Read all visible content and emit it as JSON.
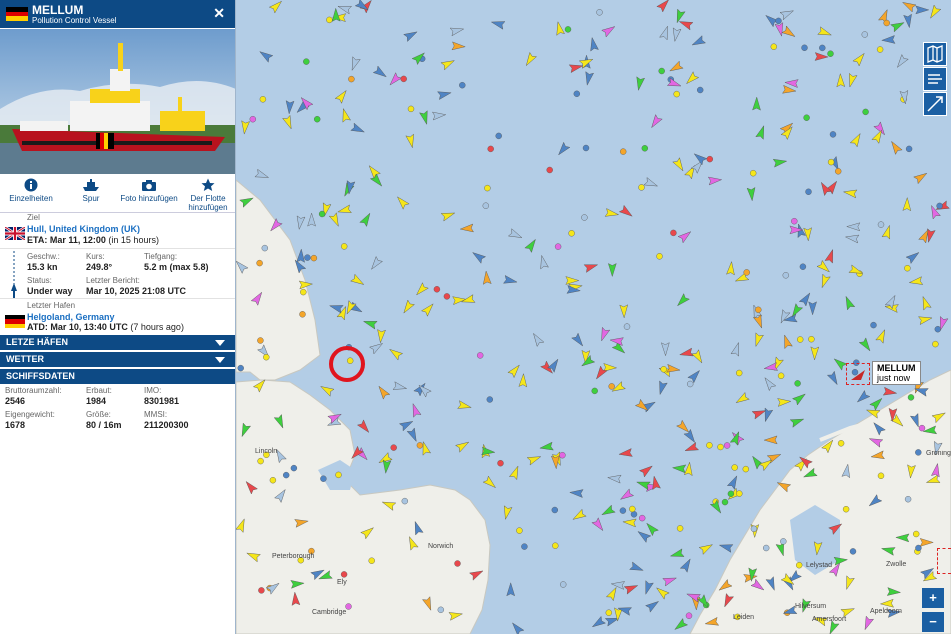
{
  "vessel": {
    "name": "MELLUM",
    "type": "Pollution Control Vessel",
    "flag_colors": [
      "#000000",
      "#dd0000",
      "#ffce00"
    ]
  },
  "actions": [
    {
      "label": "Einzelheiten",
      "icon": "info-icon"
    },
    {
      "label": "Spur",
      "icon": "ship-track-icon"
    },
    {
      "label": "Foto hinzufügen",
      "icon": "camera-icon"
    },
    {
      "label": "Der Flotte hinzufügen",
      "icon": "star-icon"
    }
  ],
  "destination": {
    "label": "Ziel",
    "port": "Hull, United Kingdom (UK)",
    "eta_label": "ETA:",
    "eta": "Mar 11, 12:00",
    "eta_rel": "(in 15 hours)"
  },
  "voyage": {
    "speed_label": "Geschw.:",
    "speed": "15.3 kn",
    "course_label": "Kurs:",
    "course": "249.8°",
    "draught_label": "Tiefgang:",
    "draught": "5.2 m",
    "draught_max": "(max 5.8)",
    "status_label": "Status:",
    "status": "Under way",
    "report_label": "Letzter Bericht:",
    "report": "Mar 10, 2025 21:08 UTC"
  },
  "last_port": {
    "label": "Letzter Hafen",
    "port": "Helgoland, Germany",
    "atd_label": "ATD:",
    "atd": "Mar 10, 13:40 UTC",
    "atd_rel": "(7 hours ago)"
  },
  "sections": [
    "LETZE HÄFEN",
    "WETTER",
    "SCHIFFSDATEN"
  ],
  "ship_data": {
    "gt_label": "Bruttoraumzahl:",
    "gt": "2546",
    "built_label": "Erbaut:",
    "built": "1984",
    "imo_label": "IMO:",
    "imo": "8301981",
    "dwt_label": "Eigengewicht:",
    "dwt": "1678",
    "size_label": "Größe:",
    "size": "80 / 16m",
    "mmsi_label": "MMSI:",
    "mmsi": "211200300"
  },
  "map": {
    "callout_name": "MELLUM",
    "callout_time": "just now",
    "cities": [
      "Lincoln",
      "Peterborough",
      "Ely",
      "Cambridge",
      "Norwich",
      "Apeldoorn",
      "Zwolle",
      "Groningen",
      "Hilversum",
      "Amersfoort",
      "Leiden",
      "Lelystad"
    ],
    "zoom_in": "+",
    "zoom_out": "−",
    "colors": {
      "sea": "#b3cde6",
      "land": "#efefea",
      "panel_header": "#0d4a85"
    }
  }
}
